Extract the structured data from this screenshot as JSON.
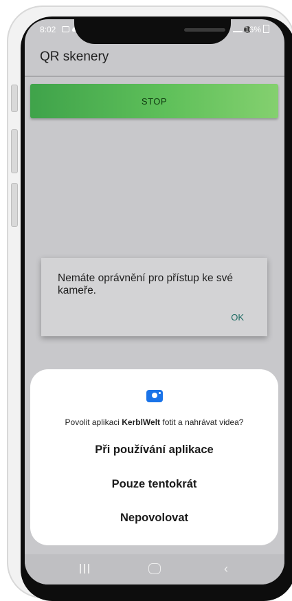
{
  "status_bar": {
    "time": "8:02",
    "right": "16%",
    "icons": [
      "image-icon",
      "cloud-icon",
      "signal-icon",
      "battery-icon"
    ]
  },
  "app": {
    "title": "QR skenery",
    "stop_label": "STOP",
    "accent_color": "#4caf50"
  },
  "alert": {
    "message": "Nemáte oprávnění pro přístup ke své kameře.",
    "ok_label": "OK"
  },
  "permission": {
    "icon": "camera-icon",
    "question_prefix": "Povolit aplikaci ",
    "app_name": "KerblWelt",
    "question_suffix": " fotit a nahrávat videa?",
    "options": [
      "Při používání aplikace",
      "Pouze tentokrát",
      "Nepovolovat"
    ]
  },
  "navbar": {
    "icons": [
      "recents-icon",
      "home-icon",
      "back-icon"
    ],
    "back_glyph": "‹"
  }
}
